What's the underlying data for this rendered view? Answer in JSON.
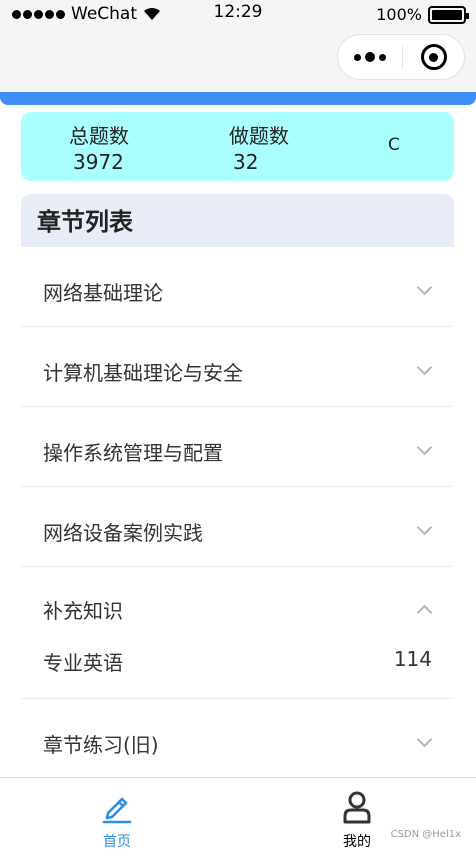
{
  "status_bar": {
    "carrier": "WeChat",
    "time": "12:29",
    "battery": "100%"
  },
  "stats": {
    "total_label": "总题数",
    "total_value": "3972",
    "done_label": "做题数",
    "done_value": "32",
    "refresh_glyph": "C"
  },
  "chapter_list": {
    "title": "章节列表",
    "items": [
      {
        "label": "网络基础理论",
        "expanded": false
      },
      {
        "label": "计算机基础理论与安全",
        "expanded": false
      },
      {
        "label": "操作系统管理与配置",
        "expanded": false
      },
      {
        "label": "网络设备案例实践",
        "expanded": false
      },
      {
        "label": "补充知识",
        "expanded": true,
        "sub": {
          "label": "专业英语",
          "count": "114"
        }
      },
      {
        "label": "章节练习(旧)",
        "expanded": false
      }
    ]
  },
  "tabbar": {
    "home": "首页",
    "mine": "我的",
    "active_color": "#2d8ee8"
  },
  "watermark": "CSDN @Hel1x",
  "colors": {
    "accent_blue": "#3b8ff7",
    "stats_bg": "#aaffff",
    "header_bg": "#e8ecf7"
  }
}
